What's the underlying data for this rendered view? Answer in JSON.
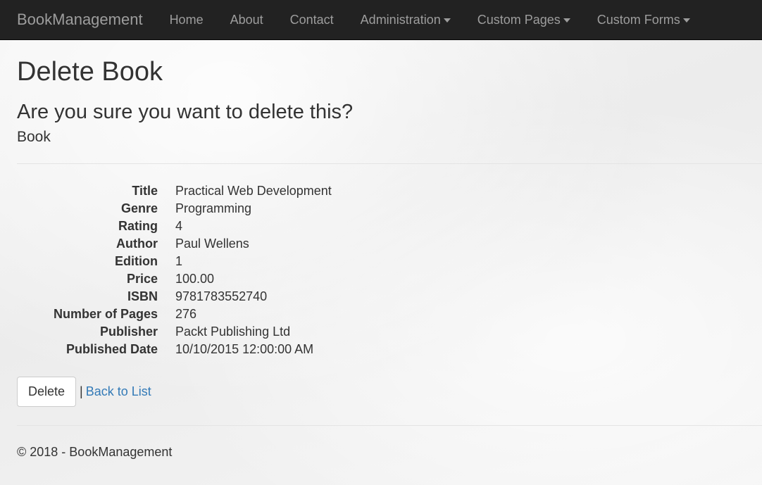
{
  "navbar": {
    "brand": "BookManagement",
    "items": [
      {
        "label": "Home",
        "dropdown": false
      },
      {
        "label": "About",
        "dropdown": false
      },
      {
        "label": "Contact",
        "dropdown": false
      },
      {
        "label": "Administration",
        "dropdown": true
      },
      {
        "label": "Custom Pages",
        "dropdown": true
      },
      {
        "label": "Custom Forms",
        "dropdown": true
      }
    ]
  },
  "main": {
    "title": "Delete Book",
    "confirm_text": "Are you sure you want to delete this?",
    "entity_name": "Book",
    "fields": [
      {
        "label": "Title",
        "value": "Practical Web Development"
      },
      {
        "label": "Genre",
        "value": "Programming"
      },
      {
        "label": "Rating",
        "value": "4"
      },
      {
        "label": "Author",
        "value": "Paul Wellens"
      },
      {
        "label": "Edition",
        "value": "1"
      },
      {
        "label": "Price",
        "value": "100.00"
      },
      {
        "label": "ISBN",
        "value": "9781783552740"
      },
      {
        "label": "Number of Pages",
        "value": "276"
      },
      {
        "label": "Publisher",
        "value": "Packt Publishing Ltd"
      },
      {
        "label": "Published Date",
        "value": "10/10/2015 12:00:00 AM"
      }
    ],
    "delete_label": "Delete",
    "separator": "|",
    "back_label": "Back to List"
  },
  "footer": {
    "text": "© 2018 - BookManagement"
  },
  "colors": {
    "navbar_bg": "#222222",
    "navbar_text": "#9d9d9d",
    "link": "#337ab7"
  }
}
